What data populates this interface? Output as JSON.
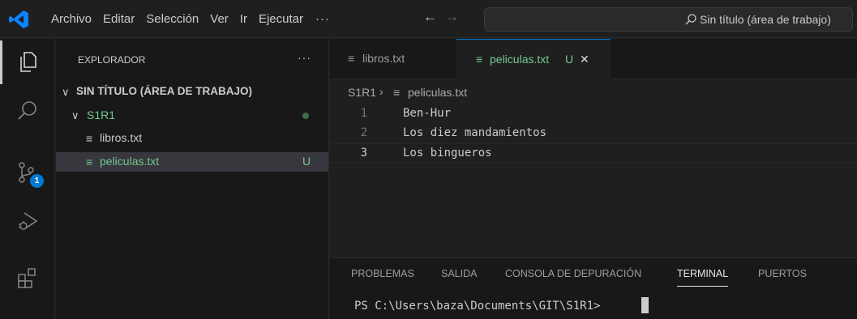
{
  "titlebar": {
    "menu": [
      "Archivo",
      "Editar",
      "Selección",
      "Ver",
      "Ir",
      "Ejecutar"
    ],
    "more": "···",
    "back": "←",
    "forward": "→",
    "search_text": "Sin título (área de trabajo)"
  },
  "activitybar": {
    "items": [
      "explorer-icon",
      "search-icon",
      "source-control-icon",
      "run-debug-icon",
      "extensions-icon"
    ],
    "scm_badge": "1",
    "accent": "#0078d4"
  },
  "sidebar": {
    "title": "EXPLORADOR",
    "more": "···",
    "workspace": "SIN TÍTULO (ÁREA DE TRABAJO)",
    "folder": "S1R1",
    "files": [
      {
        "name": "libros.txt",
        "status": ""
      },
      {
        "name": "peliculas.txt",
        "status": "U"
      }
    ],
    "file_icon": "≡",
    "untracked_color": "#73c991"
  },
  "editor": {
    "tabs": [
      {
        "label": "libros.txt",
        "active": false
      },
      {
        "label": "peliculas.txt",
        "status": "U",
        "active": true,
        "close": "✕"
      }
    ],
    "breadcrumb": {
      "folder": "S1R1",
      "sep": "›",
      "file": "peliculas.txt"
    },
    "lines": [
      {
        "n": "1",
        "text": "Ben-Hur"
      },
      {
        "n": "2",
        "text": "Los diez mandamientos"
      },
      {
        "n": "3",
        "text": "Los bingueros"
      }
    ],
    "current_line": 3
  },
  "panel": {
    "tabs": [
      "PROBLEMAS",
      "SALIDA",
      "CONSOLA DE DEPURACIÓN",
      "TERMINAL",
      "PUERTOS"
    ],
    "active_tab": "TERMINAL",
    "prompt": "PS C:\\Users\\baza\\Documents\\GIT\\S1R1>"
  }
}
